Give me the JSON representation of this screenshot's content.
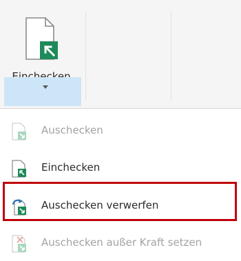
{
  "ribbon": {
    "checkin_button": {
      "label": "Einchecken",
      "icon": "checkin-icon"
    }
  },
  "menu": {
    "items": [
      {
        "label": "Auschecken",
        "icon": "checkout-icon",
        "disabled": true
      },
      {
        "label": "Einchecken",
        "icon": "checkin-icon",
        "disabled": false
      },
      {
        "label": "Auschecken verwerfen",
        "icon": "discard-checkout-icon",
        "disabled": false,
        "highlighted": true
      },
      {
        "label": "Auschecken außer Kraft setzen",
        "icon": "override-checkout-icon",
        "disabled": true
      }
    ]
  },
  "colors": {
    "accent_green": "#1e8a5a",
    "dropdown_highlight": "#cde6f7",
    "highlight_border": "#c0000b"
  }
}
